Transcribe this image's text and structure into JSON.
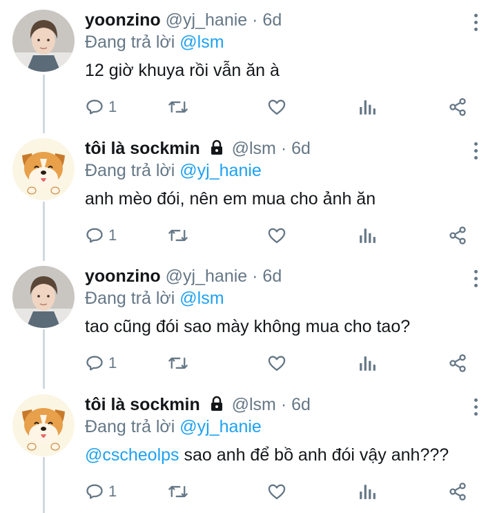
{
  "tweets": [
    {
      "user": "yoonzino",
      "handle": "@yj_hanie",
      "sep": "·",
      "time": "6d",
      "reply_prefix": "Đang trả lời",
      "reply_to": "@lsm",
      "text_mention": "",
      "text": "12 giờ khuya rồi vẫn ăn à",
      "reply_count": "1",
      "avatar": "photo-avatar",
      "locked": false
    },
    {
      "user": "tôi là sockmin",
      "handle": "@lsm",
      "sep": "·",
      "time": "6d",
      "reply_prefix": "Đang trả lời",
      "reply_to": "@yj_hanie",
      "text_mention": "",
      "text": "anh mèo đói, nên em mua cho ảnh ăn",
      "reply_count": "1",
      "avatar": "dog-cartoon-avatar",
      "locked": true
    },
    {
      "user": "yoonzino",
      "handle": "@yj_hanie",
      "sep": "·",
      "time": "6d",
      "reply_prefix": "Đang trả lời",
      "reply_to": "@lsm",
      "text_mention": "",
      "text": "tao cũng đói sao mày không mua cho tao?",
      "reply_count": "1",
      "avatar": "photo-avatar",
      "locked": false
    },
    {
      "user": "tôi là sockmin",
      "handle": "@lsm",
      "sep": "·",
      "time": "6d",
      "reply_prefix": "Đang trả lời",
      "reply_to": "@yj_hanie",
      "text_mention": "@cscheolps",
      "text": "sao anh để bồ anh đói vậy anh???",
      "reply_count": "1",
      "avatar": "dog-cartoon-avatar",
      "locked": true
    }
  ],
  "icons": [
    "reply-icon",
    "retweet-icon",
    "like-icon",
    "analytics-icon",
    "share-icon",
    "more-icon",
    "lock-icon"
  ],
  "colors": {
    "mention": "#1da1f2",
    "muted": "#657786",
    "text": "#14171a",
    "thread_line": "#cfd9de"
  }
}
